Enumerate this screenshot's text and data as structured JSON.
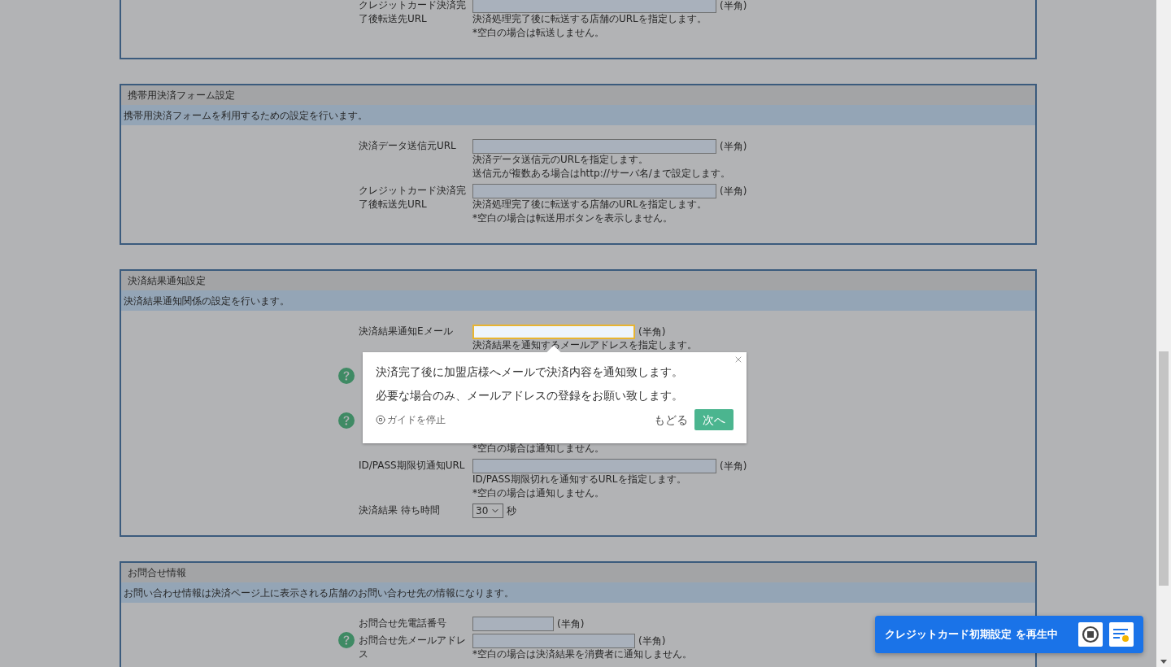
{
  "sections": [
    {
      "rows": [
        {
          "kind": "url",
          "label": "クレジットカード決済完了後転送先URL",
          "help": false,
          "focused": false,
          "unit": "(半角)",
          "notes": [
            "決済処理完了後に転送する店舗のURLを指定します。",
            "*空白の場合は転送しません。"
          ]
        }
      ]
    },
    {
      "title": "携帯用決済フォーム設定",
      "description": "携帯用決済フォームを利用するための設定を行います。",
      "rows": [
        {
          "kind": "url",
          "label": "決済データ送信元URL",
          "help": false,
          "focused": false,
          "unit": "(半角)",
          "notes": [
            "決済データ送信元のURLを指定します。",
            "送信元が複数ある場合はhttp://サーバ名/まで設定します。"
          ]
        },
        {
          "kind": "url",
          "label": "クレジットカード決済完了後転送先URL",
          "help": false,
          "focused": false,
          "unit": "(半角)",
          "notes": [
            "決済処理完了後に転送する店舗のURLを指定します。",
            "*空白の場合は転送用ボタンを表示しません。"
          ]
        }
      ]
    },
    {
      "title": "決済結果通知設定",
      "description": "決済結果通知関係の設定を行います。",
      "rows": [
        {
          "kind": "email",
          "label": "決済結果通知Eメール",
          "help": false,
          "focused": true,
          "unit": "(半角)",
          "notes": [
            "決済結果を通知するメールアドレスを指定します。"
          ]
        },
        {
          "kind": "covered",
          "help": true
        },
        {
          "kind": "covered",
          "help": true,
          "notes": [
            "*空白の場合は通知しません。"
          ]
        },
        {
          "kind": "url",
          "label": "ID/PASS期限切通知URL",
          "help": false,
          "focused": false,
          "unit": "(半角)",
          "notes": [
            "ID/PASS期限切れを通知するURLを指定します。",
            "*空白の場合は通知しません。"
          ]
        },
        {
          "kind": "select",
          "label": "決済結果 待ち時間",
          "help": false,
          "value": "30",
          "unit": "秒"
        }
      ]
    },
    {
      "title": "お問合せ情報",
      "description": "お問い合わせ情報は決済ページ上に表示される店舗のお問い合わせ先の情報になります。",
      "rows": [
        {
          "kind": "phone",
          "label": "お問合せ先電話番号",
          "help": false,
          "focused": false,
          "unit": "(半角)"
        },
        {
          "kind": "email",
          "label": "お問合せ先メールアドレス",
          "help": true,
          "focused": false,
          "unit": "(半角)",
          "notes": [
            "*空白の場合は決済結果を消費者に通知しません。"
          ]
        }
      ]
    }
  ],
  "guide_popover": {
    "lines": [
      "決済完了後に加盟店様へメールで決済内容を通知致します。",
      "必要な場合のみ、メールアドレスの登録をお願い致します。"
    ],
    "stop_label": "ガイドを停止",
    "back_label": "もどる",
    "next_label": "次へ"
  },
  "player": {
    "title": "クレジットカード初期設定 を再生中"
  }
}
